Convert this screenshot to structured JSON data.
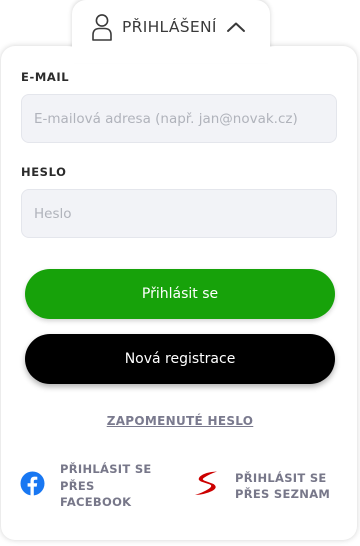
{
  "tab": {
    "label": "PŘIHLÁŠENÍ",
    "user_icon": "user-icon",
    "chevron_icon": "chevron-up-icon"
  },
  "form": {
    "email_label": "E-MAIL",
    "email_placeholder": "E-mailová adresa (např. jan@novak.cz)",
    "email_value": "",
    "password_label": "HESLO",
    "password_placeholder": "Heslo",
    "password_value": ""
  },
  "buttons": {
    "login_label": "Přihlásit se",
    "register_label": "Nová registrace"
  },
  "forgot_password": "ZAPOMENUTÉ HESLO",
  "social": {
    "facebook_label": "PŘIHLÁSIT SE PŘES FACEBOOK",
    "seznam_label": "PŘIHLÁSIT SE PŘES SEZNAM",
    "facebook_icon": "facebook-icon",
    "seznam_icon": "seznam-icon"
  },
  "colors": {
    "login_button": "#17a20a",
    "register_button": "#000000",
    "facebook_blue": "#1877f2",
    "seznam_red": "#cc0000"
  }
}
